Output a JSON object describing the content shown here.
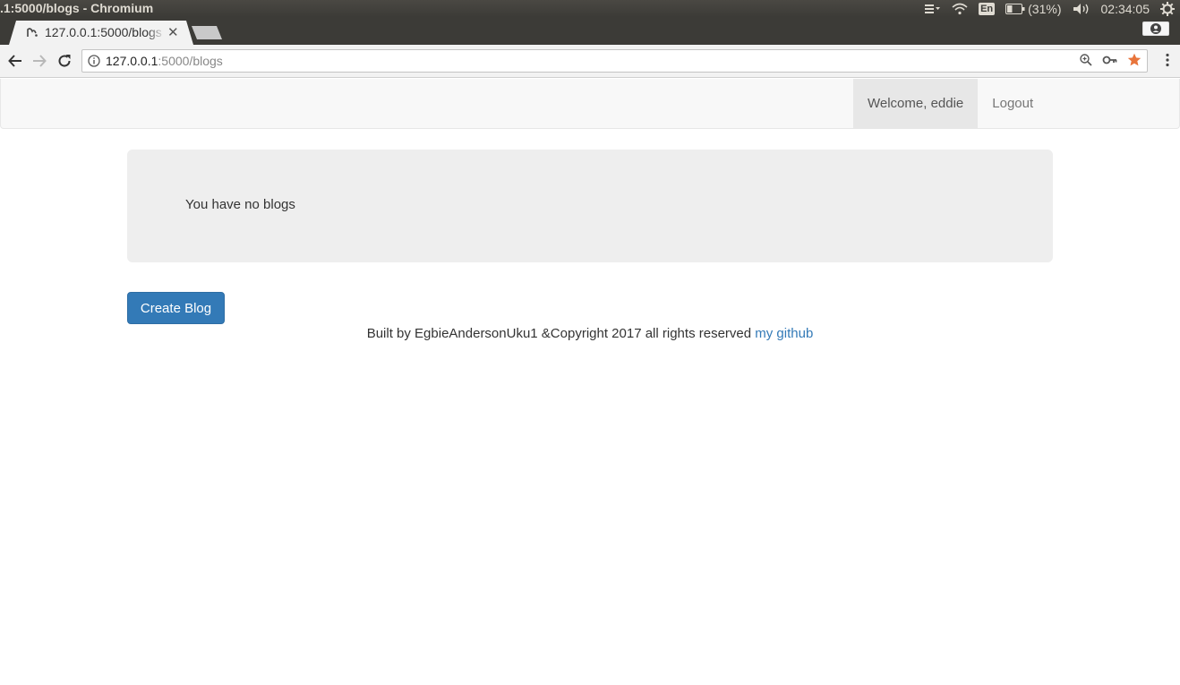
{
  "os": {
    "window_title": ".1:5000/blogs - Chromium",
    "keyboard_layout": "En",
    "battery": "(31%)",
    "clock": "02:34:05"
  },
  "browser": {
    "tab_title": "127.0.0.1:5000/blogs",
    "url_host": "127.0.0.1",
    "url_path": ":5000/blogs",
    "star_color": "#e8743b"
  },
  "navbar": {
    "welcome": "Welcome, eddie",
    "logout": "Logout"
  },
  "main": {
    "empty_message": "You have no blogs",
    "create_button": "Create Blog"
  },
  "footer": {
    "text": "Built by EgbieAndersonUku1 &Copyright 2017 all rights reserved",
    "link": "my github"
  },
  "colors": {
    "primary": "#337ab7",
    "jumbotron_bg": "#eeeeee",
    "navbar_bg": "#f8f8f8"
  }
}
